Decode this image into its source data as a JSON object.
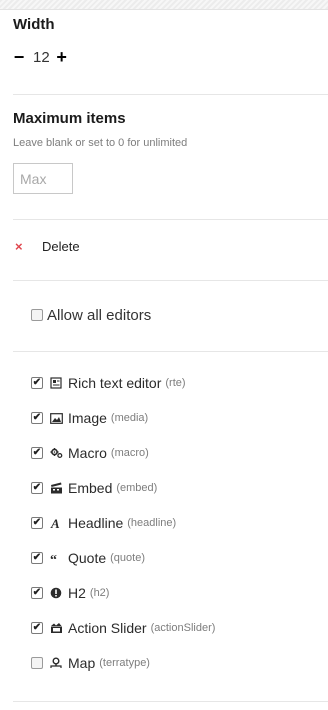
{
  "width_section": {
    "label": "Width",
    "minus": "−",
    "value": "12",
    "plus": "+"
  },
  "max_items": {
    "label": "Maximum items",
    "description": "Leave blank or set to 0 for unlimited",
    "placeholder": "Max",
    "value": ""
  },
  "delete": {
    "icon_glyph": "×",
    "label": "Delete",
    "color": "#e0464e"
  },
  "allow_all": {
    "label": "Allow all editors",
    "checked": false
  },
  "editors": [
    {
      "name": "Rich text editor",
      "alias": "(rte)",
      "icon": "rte-icon",
      "checked": true
    },
    {
      "name": "Image",
      "alias": "(media)",
      "icon": "image-icon",
      "checked": true
    },
    {
      "name": "Macro",
      "alias": "(macro)",
      "icon": "gears-icon",
      "checked": true
    },
    {
      "name": "Embed",
      "alias": "(embed)",
      "icon": "movie-alt-icon",
      "checked": true
    },
    {
      "name": "Headline",
      "alias": "(headline)",
      "icon": "font-icon",
      "checked": true
    },
    {
      "name": "Quote",
      "alias": "(quote)",
      "icon": "quote-icon",
      "checked": true
    },
    {
      "name": "H2",
      "alias": "(h2)",
      "icon": "info-icon",
      "checked": true
    },
    {
      "name": "Action Slider",
      "alias": "(actionSlider)",
      "icon": "slideshow-icon",
      "checked": true
    },
    {
      "name": "Map",
      "alias": "(terratype)",
      "icon": "map-location-icon",
      "checked": false
    }
  ]
}
